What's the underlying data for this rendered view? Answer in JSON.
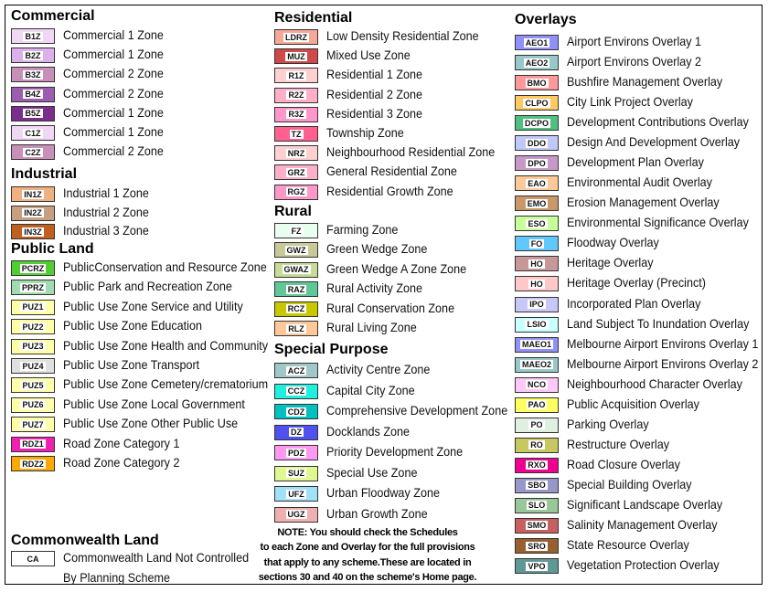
{
  "sections": [
    {
      "title": "Commercial",
      "items": [
        {
          "code": "B1Z",
          "label": "Commercial 1 Zone",
          "color": "#f0d8f5"
        },
        {
          "code": "B2Z",
          "label": "Commercial 1 Zone",
          "color": "#dcb0ea"
        },
        {
          "code": "B3Z",
          "label": "Commercial 2 Zone",
          "color": "#c890b8"
        },
        {
          "code": "B4Z",
          "label": "Commercial 2 Zone",
          "color": "#9c5cb0"
        },
        {
          "code": "B5Z",
          "label": "Commercial 1 Zone",
          "color": "#7a2e8c"
        },
        {
          "code": "C1Z",
          "label": "Commercial 1 Zone",
          "color": "#f0d8f5"
        },
        {
          "code": "C2Z",
          "label": "Commercial 2 Zone",
          "color": "#c890b8"
        }
      ]
    },
    {
      "title": "Industrial",
      "items": [
        {
          "code": "IN1Z",
          "label": "Industrial 1 Zone",
          "color": "#f0b080"
        },
        {
          "code": "IN2Z",
          "label": "Industrial 2 Zone",
          "color": "#c8a080"
        },
        {
          "code": "IN3Z",
          "label": "Industrial 3 Zone",
          "color": "#c06020"
        }
      ]
    },
    {
      "title": "Public Land",
      "items": [
        {
          "code": "PCRZ",
          "label": "PublicConservation and Resource Zone",
          "color": "#50d030"
        },
        {
          "code": "PPRZ",
          "label": "Public Park and Recreation Zone",
          "color": "#a0dcb0"
        },
        {
          "code": "PUZ1",
          "label": "Public Use Zone Service and Utility",
          "color": "#ffffa8"
        },
        {
          "code": "PUZ2",
          "label": "Public Use Zone Education",
          "color": "#ffffa8"
        },
        {
          "code": "PUZ3",
          "label": "Public Use Zone Health and Community",
          "color": "#ffffa8"
        },
        {
          "code": "PUZ4",
          "label": "Public Use Zone Transport",
          "color": "#e0e0e0"
        },
        {
          "code": "PUZ5",
          "label": "Public Use Zone Cemetery/crematorium",
          "color": "#ffffa8"
        },
        {
          "code": "PUZ6",
          "label": "Public Use Zone Local Government",
          "color": "#ffffa8"
        },
        {
          "code": "PUZ7",
          "label": "Public Use Zone Other Public Use",
          "color": "#ffffa8"
        },
        {
          "code": "RDZ1",
          "label": "Road Zone Category 1",
          "color": "#f020b0"
        },
        {
          "code": "RDZ2",
          "label": "Road Zone Category 2",
          "color": "#ffa800"
        }
      ]
    },
    {
      "title": "Commonwealth Land",
      "items": [
        {
          "code": "CA",
          "label": "Commonwealth Land Not Controlled",
          "label2": "By Planning Scheme",
          "color": "#ffffff"
        }
      ]
    },
    {
      "title": "Residential",
      "items": [
        {
          "code": "LDRZ",
          "label": "Low Density Residential Zone",
          "color": "#f8a898"
        },
        {
          "code": "MUZ",
          "label": "Mixed Use Zone",
          "color": "#d04848"
        },
        {
          "code": "R1Z",
          "label": "Residential 1 Zone",
          "color": "#ffd0d0"
        },
        {
          "code": "R2Z",
          "label": "Residential 2 Zone",
          "color": "#ffb0c8"
        },
        {
          "code": "R3Z",
          "label": "Residential 3 Zone",
          "color": "#ff98c8"
        },
        {
          "code": "TZ",
          "label": "Township Zone",
          "color": "#ff6090"
        },
        {
          "code": "NRZ",
          "label": "Neighbourhood Residential Zone",
          "color": "#ffd0d0"
        },
        {
          "code": "GRZ",
          "label": "General Residential Zone",
          "color": "#ffb0c8"
        },
        {
          "code": "RGZ",
          "label": "Residential Growth Zone",
          "color": "#ff98c8"
        }
      ]
    },
    {
      "title": "Rural",
      "items": [
        {
          "code": "FZ",
          "label": "Farming Zone",
          "color": "#e8fff0"
        },
        {
          "code": "GWZ",
          "label": "Green Wedge Zone",
          "color": "#c8c898"
        },
        {
          "code": "GWAZ",
          "label": "Green Wedge A Zone Zone",
          "color": "#c8dc98"
        },
        {
          "code": "RAZ",
          "label": "Rural Activity Zone",
          "color": "#60c898"
        },
        {
          "code": "RCZ",
          "label": "Rural Conservation Zone",
          "color": "#c8c800"
        },
        {
          "code": "RLZ",
          "label": "Rural Living Zone",
          "color": "#ffc898"
        }
      ]
    },
    {
      "title": "Special Purpose",
      "items": [
        {
          "code": "ACZ",
          "label": "Activity Centre Zone",
          "color": "#a0c8c8"
        },
        {
          "code": "CCZ",
          "label": "Capital City Zone",
          "color": "#20f0e0"
        },
        {
          "code": "CDZ",
          "label": "Comprehensive Development Zone",
          "color": "#00c0c0"
        },
        {
          "code": "DZ",
          "label": "Docklands Zone",
          "color": "#5050f0"
        },
        {
          "code": "PDZ",
          "label": "Priority Development Zone",
          "color": "#ff98f0"
        },
        {
          "code": "SUZ",
          "label": "Special Use Zone",
          "color": "#e0f890"
        },
        {
          "code": "UFZ",
          "label": "Urban Floodway Zone",
          "color": "#a0e0f8"
        },
        {
          "code": "UGZ",
          "label": "Urban Growth Zone",
          "color": "#f0b0b0"
        }
      ]
    },
    {
      "title": "Overlays",
      "items": [
        {
          "code": "AEO1",
          "label": "Airport Environs Overlay 1",
          "color": "#9090f8"
        },
        {
          "code": "AEO2",
          "label": "Airport Environs Overlay 2",
          "color": "#98c8c8"
        },
        {
          "code": "BMO",
          "label": "Bushfire Management Overlay",
          "color": "#ff9898"
        },
        {
          "code": "CLPO",
          "label": "City Link Project Overlay",
          "color": "#ffc860"
        },
        {
          "code": "DCPO",
          "label": "Development Contributions Overlay",
          "color": "#50c080"
        },
        {
          "code": "DDO",
          "label": "Design And Development Overlay",
          "color": "#c0c8f8"
        },
        {
          "code": "DPO",
          "label": "Development Plan Overlay",
          "color": "#c898c8"
        },
        {
          "code": "EAO",
          "label": "Environmental Audit Overlay",
          "color": "#ffc898"
        },
        {
          "code": "EMO",
          "label": "Erosion Management Overlay",
          "color": "#c89868"
        },
        {
          "code": "ESO",
          "label": "Environmental Significance Overlay",
          "color": "#c8ff98"
        },
        {
          "code": "FO",
          "label": "Floodway Overlay",
          "color": "#60c8ff"
        },
        {
          "code": "HO",
          "label": "Heritage Overlay",
          "color": "#c89898"
        },
        {
          "code": "HO",
          "label": "Heritage Overlay (Precinct)",
          "color": "#ffc8c8"
        },
        {
          "code": "IPO",
          "label": "Incorporated Plan Overlay",
          "color": "#c8c8f8"
        },
        {
          "code": "LSIO",
          "label": "Land Subject To Inundation Overlay",
          "color": "#c8ffff"
        },
        {
          "code": "MAEO1",
          "label": "Melbourne Airport Environs Overlay 1",
          "color": "#9090f8"
        },
        {
          "code": "MAEO2",
          "label": "Melbourne Airport Environs Overlay 2",
          "color": "#98c8c8"
        },
        {
          "code": "NCO",
          "label": "Neighbourhood Character Overlay",
          "color": "#ffc8f8"
        },
        {
          "code": "PAO",
          "label": "Public Acquisition Overlay",
          "color": "#ffff60"
        },
        {
          "code": "PO",
          "label": "Parking Overlay",
          "color": "#e0f0e0"
        },
        {
          "code": "RO",
          "label": "Restructure Overlay",
          "color": "#c8c860"
        },
        {
          "code": "RXO",
          "label": "Road Closure Overlay",
          "color": "#f00090"
        },
        {
          "code": "SBO",
          "label": "Special Building Overlay",
          "color": "#9898c8"
        },
        {
          "code": "SLO",
          "label": "Significant Landscape Overlay",
          "color": "#98c898"
        },
        {
          "code": "SMO",
          "label": "Salinity Management Overlay",
          "color": "#c86060"
        },
        {
          "code": "SRO",
          "label": "State Resource Overlay",
          "color": "#986030"
        },
        {
          "code": "VPO",
          "label": "Vegetation Protection Overlay",
          "color": "#609898"
        }
      ]
    }
  ],
  "note": [
    "NOTE: You should check the Schedules",
    "to each Zone and Overlay for the full provisions",
    "that apply to any scheme.These are located in",
    "sections 30 and 40 on the scheme's Home page."
  ]
}
